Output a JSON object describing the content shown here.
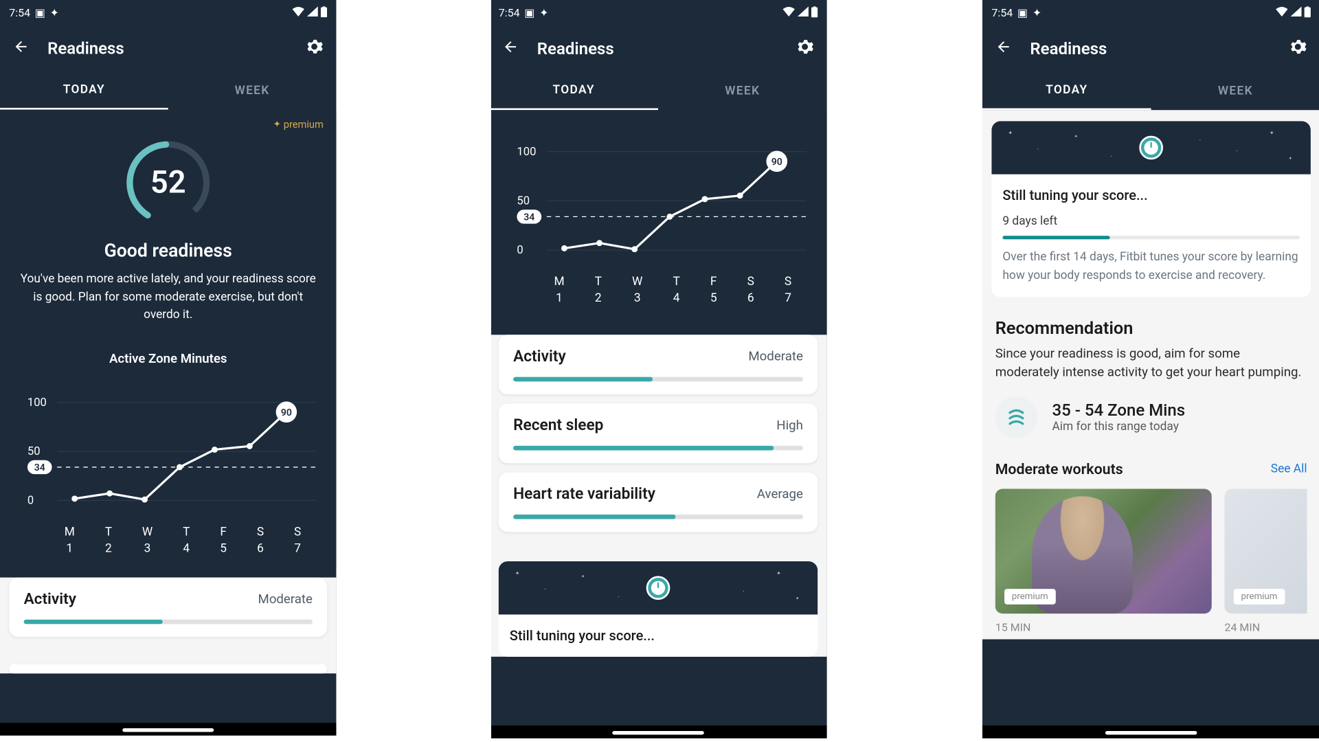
{
  "status": {
    "time": "7:54"
  },
  "appbar": {
    "title": "Readiness"
  },
  "tabs": {
    "today": "TODAY",
    "week": "WEEK"
  },
  "premium_label": "premium",
  "gauge": {
    "score": "52",
    "label": "Good readiness",
    "desc": "You've been more active lately, and your readiness score is good. Plan for some moderate exercise, but don't overdo it."
  },
  "chart_data": {
    "type": "line",
    "title": "Active Zone Minutes",
    "ylabel": "",
    "xlabel": "",
    "ylim": [
      0,
      100
    ],
    "yticks": [
      0,
      50,
      100
    ],
    "baseline": 34,
    "highlighted_value": 90,
    "categories": [
      "M",
      "T",
      "W",
      "T",
      "F",
      "S",
      "S"
    ],
    "day_numbers": [
      "1",
      "2",
      "3",
      "4",
      "5",
      "6",
      "7"
    ],
    "values": [
      2,
      8,
      1,
      34,
      52,
      56,
      90
    ]
  },
  "activity": {
    "title": "Activity",
    "level": "Moderate",
    "pct": 48
  },
  "sleep": {
    "title": "Recent sleep",
    "level": "High",
    "pct": 90
  },
  "hrv": {
    "title": "Heart rate variability",
    "level": "Average",
    "pct": 56
  },
  "tuning": {
    "title": "Still tuning your score...",
    "days_left": "9 days left",
    "pct": 36,
    "desc": "Over the first 14 days, Fitbit tunes your score by learning how your body responds to exercise and recovery."
  },
  "recommendation": {
    "heading": "Recommendation",
    "desc": "Since your readiness is good, aim for some moderately intense activity to get your heart pumping.",
    "zone_title": "35 - 54 Zone Mins",
    "zone_sub": "Aim for this range today"
  },
  "workouts": {
    "heading": "Moderate workouts",
    "see_all": "See All",
    "items": [
      {
        "duration": "15 MIN",
        "premium": "premium"
      },
      {
        "duration": "24 MIN",
        "premium": "premium"
      }
    ]
  }
}
